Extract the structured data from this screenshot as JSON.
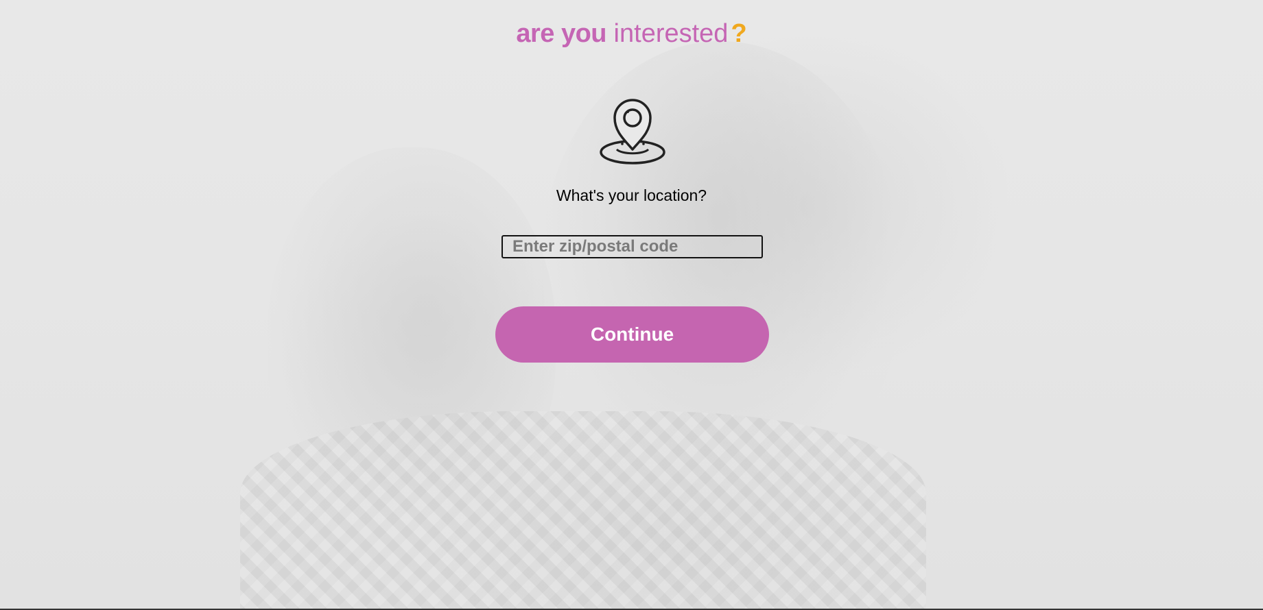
{
  "logo": {
    "part_bold": "are you",
    "part_light": " interested",
    "heart_glyph": "?"
  },
  "icon": "location-pin-icon",
  "question": "What's your location?",
  "zip": {
    "placeholder": "Enter zip/postal code",
    "value": ""
  },
  "continue_label": "Continue",
  "colors": {
    "brand_pink": "#c565b0",
    "heart_orange": "#f0a81e",
    "background": "#e9e9e9"
  }
}
